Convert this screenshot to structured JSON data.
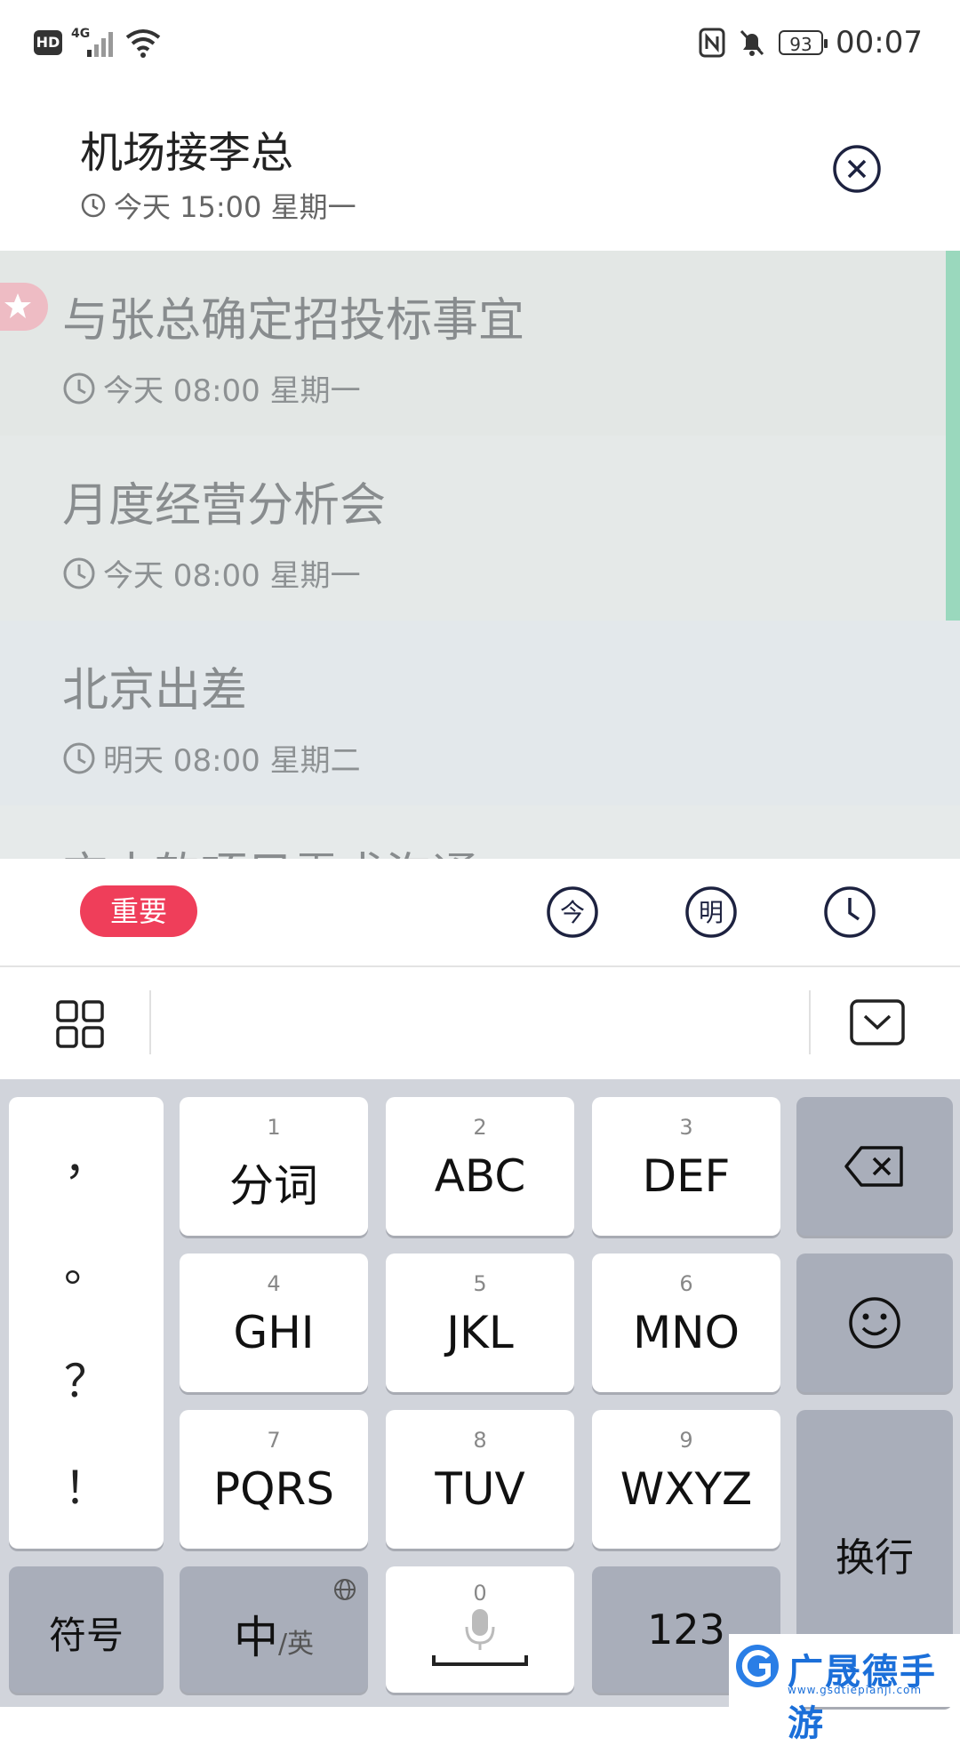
{
  "status_bar": {
    "hd": "HD",
    "network": "4G",
    "battery": "93",
    "time": "00:07",
    "icons": [
      "signal-icon",
      "wifi-icon",
      "nfc-icon",
      "bell-off-icon",
      "battery-icon"
    ]
  },
  "header": {
    "title": "机场接李总",
    "time": "今天 15:00 星期一"
  },
  "items": [
    {
      "title": "与张总确定招投标事宜",
      "time": "今天 08:00 星期一",
      "starred": true
    },
    {
      "title": "月度经营分析会",
      "time": "今天 08:00 星期一",
      "starred": false
    },
    {
      "title": "北京出差",
      "time": "明天 08:00 星期二",
      "starred": false
    },
    {
      "title": "交中软项目需求沟通",
      "time": "",
      "starred": false
    }
  ],
  "quick_bar": {
    "important_label": "重要",
    "today_label": "今",
    "tomorrow_label": "明"
  },
  "keyboard": {
    "punct": [
      "，",
      "。",
      "？",
      "！"
    ],
    "keys": [
      {
        "num": "1",
        "label": "分词"
      },
      {
        "num": "2",
        "label": "ABC"
      },
      {
        "num": "3",
        "label": "DEF"
      },
      {
        "num": "4",
        "label": "GHI"
      },
      {
        "num": "5",
        "label": "JKL"
      },
      {
        "num": "6",
        "label": "MNO"
      },
      {
        "num": "7",
        "label": "PQRS"
      },
      {
        "num": "8",
        "label": "TUV"
      },
      {
        "num": "9",
        "label": "WXYZ"
      }
    ],
    "newline": "换行",
    "symbols": "符号",
    "lang_main": "中",
    "lang_sub": "/英",
    "space_num": "0",
    "num_key": "123"
  },
  "watermark": {
    "text": "广晟德手游",
    "url": "www.gsdtiepianji.com"
  },
  "colors": {
    "important": "#ef3e5a",
    "accent": "#9ad8bd",
    "star_tag": "#eebcc4",
    "keyboard_bg": "#d1d4db",
    "watermark": "#1b6fd9"
  }
}
